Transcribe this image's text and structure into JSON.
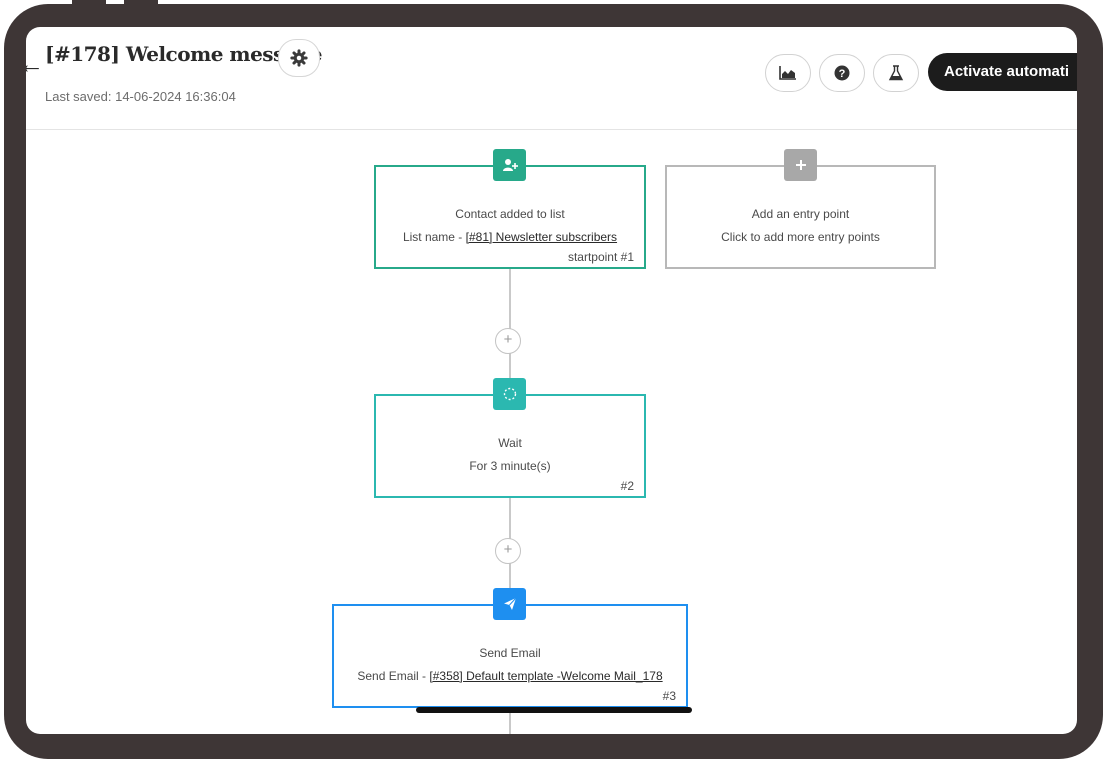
{
  "header": {
    "title": "[#178] Welcome message",
    "last_saved": "Last saved: 14-06-2024 16:36:04",
    "activate_label": "Activate automati"
  },
  "icons": {
    "back": "back-arrow-icon",
    "settings": "gear-icon",
    "stats": "area-chart-icon",
    "help": "question-circle-icon",
    "test": "flask-icon",
    "contact_add": "user-plus-icon",
    "entry_add": "plus-icon",
    "wait": "spinner-icon",
    "email": "paper-plane-icon"
  },
  "nodes": {
    "start": {
      "title": "Contact added to list",
      "detail_prefix": "List name - ",
      "detail_link": "[#81] Newsletter subscribers",
      "tag": "startpoint #1"
    },
    "entry": {
      "title": "Add an entry point",
      "detail": "Click to add more entry points"
    },
    "wait": {
      "title": "Wait",
      "detail": "For 3 minute(s)",
      "tag": "#2"
    },
    "email": {
      "title": "Send Email",
      "detail_prefix": "Send Email - ",
      "detail_link": "[#358] Default template -Welcome Mail_178",
      "tag": "#3"
    }
  },
  "colors": {
    "trigger": "#27a98a",
    "wait": "#2bb8b0",
    "email": "#1e8ff0",
    "neutral": "#a8a8a8",
    "frame": "#3e3636"
  }
}
